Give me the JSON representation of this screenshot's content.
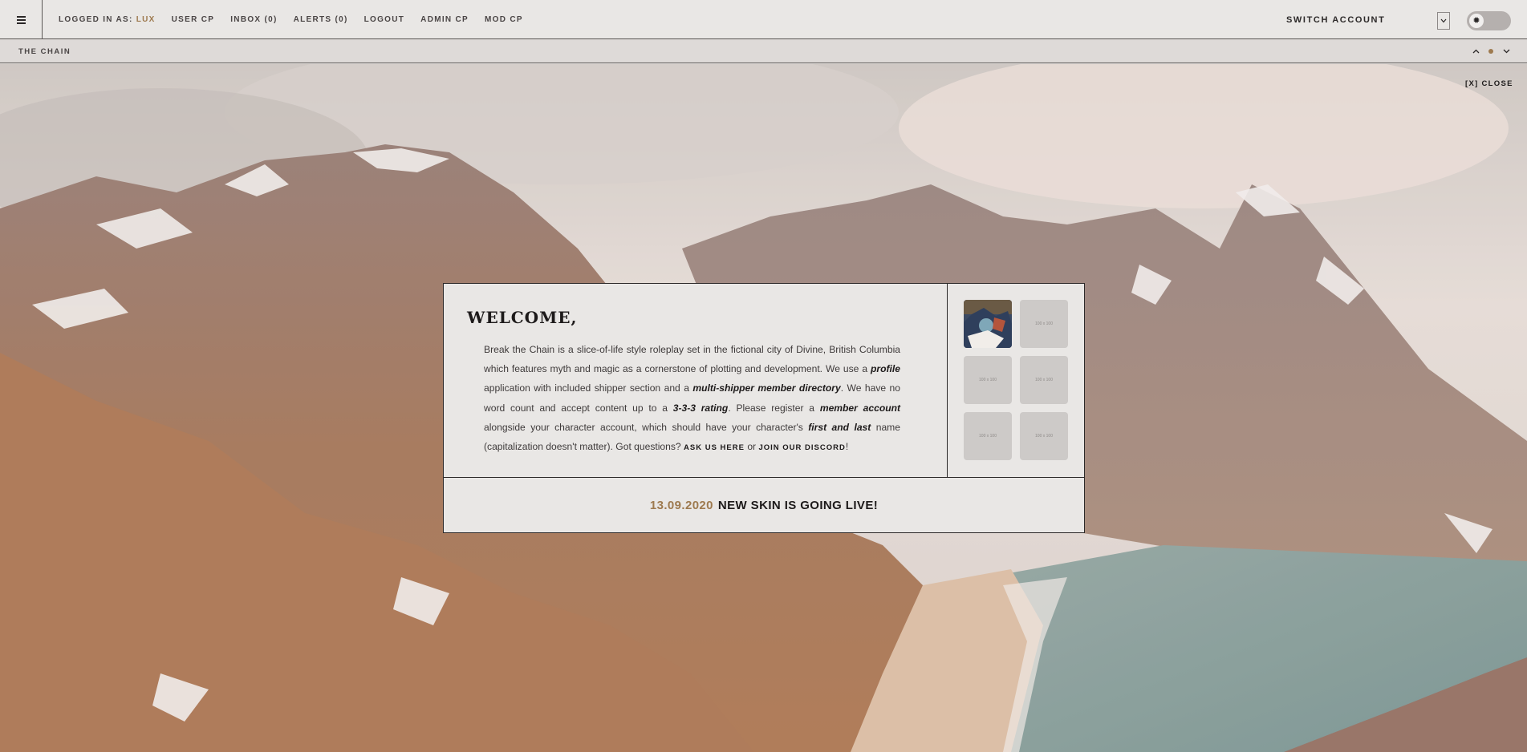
{
  "topbar": {
    "menu_icon": "hamburger-icon",
    "logged_in_label": "LOGGED IN AS:",
    "username": "LUX",
    "nav": [
      "USER CP",
      "INBOX (0)",
      "ALERTS (0)",
      "LOGOUT",
      "ADMIN CP",
      "MOD CP"
    ],
    "switch_account": "SWITCH ACCOUNT",
    "toggle_icon": "sun-icon"
  },
  "subbar": {
    "title": "THE CHAIN"
  },
  "close_label": "[X] CLOSE",
  "welcome": {
    "heading": "WELCOME,",
    "text_1": "Break the Chain is a slice-of-life style roleplay set in the fictional city of Divine, British Columbia which features myth and magic as a cornerstone of plotting and development. We use a ",
    "em_profile": "profile",
    "text_2": " application with included shipper section and a ",
    "em_directory": "multi-shipper member directory",
    "text_3": ". We have no word count and accept content up to a ",
    "em_rating": "3-3-3 rating",
    "text_4": ". Please register a ",
    "em_account": "member account",
    "text_5": " alongside your character account, which should have your character's ",
    "em_name": "first and last",
    "text_6": " name (capitalization doesn't matter). Got questions? ",
    "link_ask": "ASK US HERE",
    "text_7": " or ",
    "link_discord": "JOIN OUR DISCORD",
    "text_8": "!"
  },
  "thumbnails": [
    "",
    "100 x 100",
    "100 x 100",
    "100 x 100",
    "100 x 100",
    "100 x 100"
  ],
  "news": {
    "date": "13.09.2020",
    "headline": "NEW SKIN IS GOING LIVE!"
  },
  "colors": {
    "accent": "#9e7a4f",
    "bar_bg": "#e9e7e5",
    "border": "#2c2929"
  }
}
